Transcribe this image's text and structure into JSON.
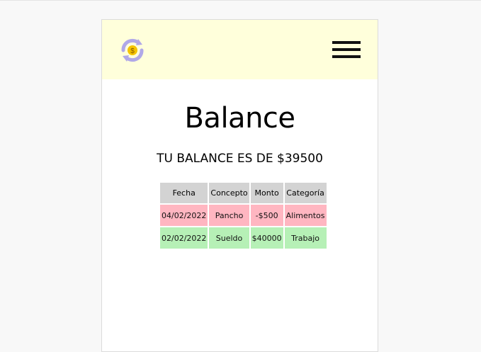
{
  "header": {
    "logo_icon": "money-refresh-logo-icon",
    "menu_icon": "hamburger-menu-icon",
    "background": "#ffffdb"
  },
  "main": {
    "title": "Balance",
    "balance_text": "TU BALANCE ES DE $39500"
  },
  "table": {
    "headers": [
      "Fecha",
      "Concepto",
      "Monto",
      "Categoría"
    ],
    "rows": [
      {
        "fecha": "04/02/2022",
        "concepto": "Pancho",
        "monto": "-$500",
        "categoria": "Alimentos",
        "type": "expense"
      },
      {
        "fecha": "02/02/2022",
        "concepto": "Sueldo",
        "monto": "$40000",
        "categoria": "Trabajo",
        "type": "income"
      }
    ]
  },
  "colors": {
    "expense": "#ffb6c1",
    "income": "#b6f0b6",
    "header_cell": "#d3d3d3"
  }
}
